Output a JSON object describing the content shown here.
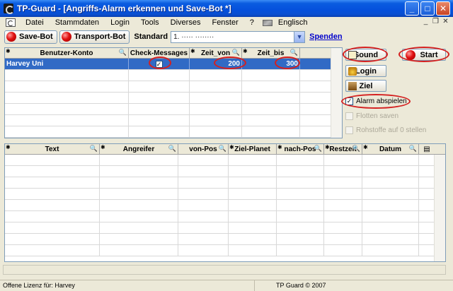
{
  "window": {
    "title": "TP-Guard - [Angriffs-Alarm erkennen und Save-Bot *]"
  },
  "window_buttons": {
    "minimize": "_",
    "maximize": "□",
    "close": "✕"
  },
  "menu": {
    "items": [
      "Datei",
      "Stammdaten",
      "Login",
      "Tools",
      "Diverses",
      "Fenster",
      "?"
    ],
    "language": "Englisch",
    "mdi": {
      "minimize": "_",
      "restore": "❐",
      "close": "✕"
    }
  },
  "toolbar": {
    "save_bot": "Save-Bot",
    "transport_bot": "Transport-Bot",
    "standard_label": "Standard",
    "combo_value": "1.  ·····  ········",
    "donate_link": "Spenden"
  },
  "accounts_grid": {
    "columns": [
      "Benutzer-Konto",
      "Check-Messages",
      "Zeit_von",
      "Zeit_bis"
    ],
    "rows": [
      {
        "account": "Harvey Uni",
        "check": "✓",
        "zeit_von": "200",
        "zeit_bis": "300"
      }
    ]
  },
  "right_panel": {
    "sound": "Sound",
    "start": "Start",
    "login": "Login",
    "ziel": "Ziel",
    "alarm_check": "✓",
    "alarm_label": "Alarm abspielen",
    "flotten_label": "Flotten saven",
    "rohstoffe_label": "Rohstoffe auf 0 stellen"
  },
  "attacks_grid": {
    "columns": [
      "Text",
      "Angreifer",
      "von-Pos",
      "Ziel-Planet",
      "nach-Pos",
      "Restzeit",
      "Datum"
    ]
  },
  "status": {
    "license": "Offene Lizenz für: Harvey",
    "copyright": "TP Guard © 2007"
  },
  "colors": {
    "selection": "#316ac5",
    "annotation": "#d42020",
    "titlebar": "#0550dc"
  }
}
